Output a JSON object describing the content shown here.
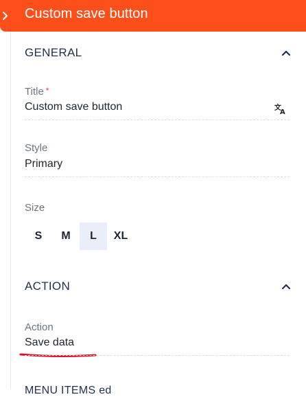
{
  "header": {
    "title": "Custom save button"
  },
  "general": {
    "title": "GENERAL",
    "title_field": {
      "label": "Title",
      "required_mark": "*",
      "value": "Custom save button"
    },
    "style_field": {
      "label": "Style",
      "value": "Primary"
    },
    "size_field": {
      "label": "Size",
      "options": [
        "S",
        "M",
        "L",
        "XL"
      ],
      "selected": "L"
    }
  },
  "action": {
    "title": "ACTION",
    "action_field": {
      "label": "Action",
      "value": "Save data"
    }
  },
  "next_section": {
    "title": "MENU ITEMS ed"
  },
  "colors": {
    "header": "#fd4f19",
    "underline": "#e0102a",
    "active_size": "#e9eef8"
  }
}
